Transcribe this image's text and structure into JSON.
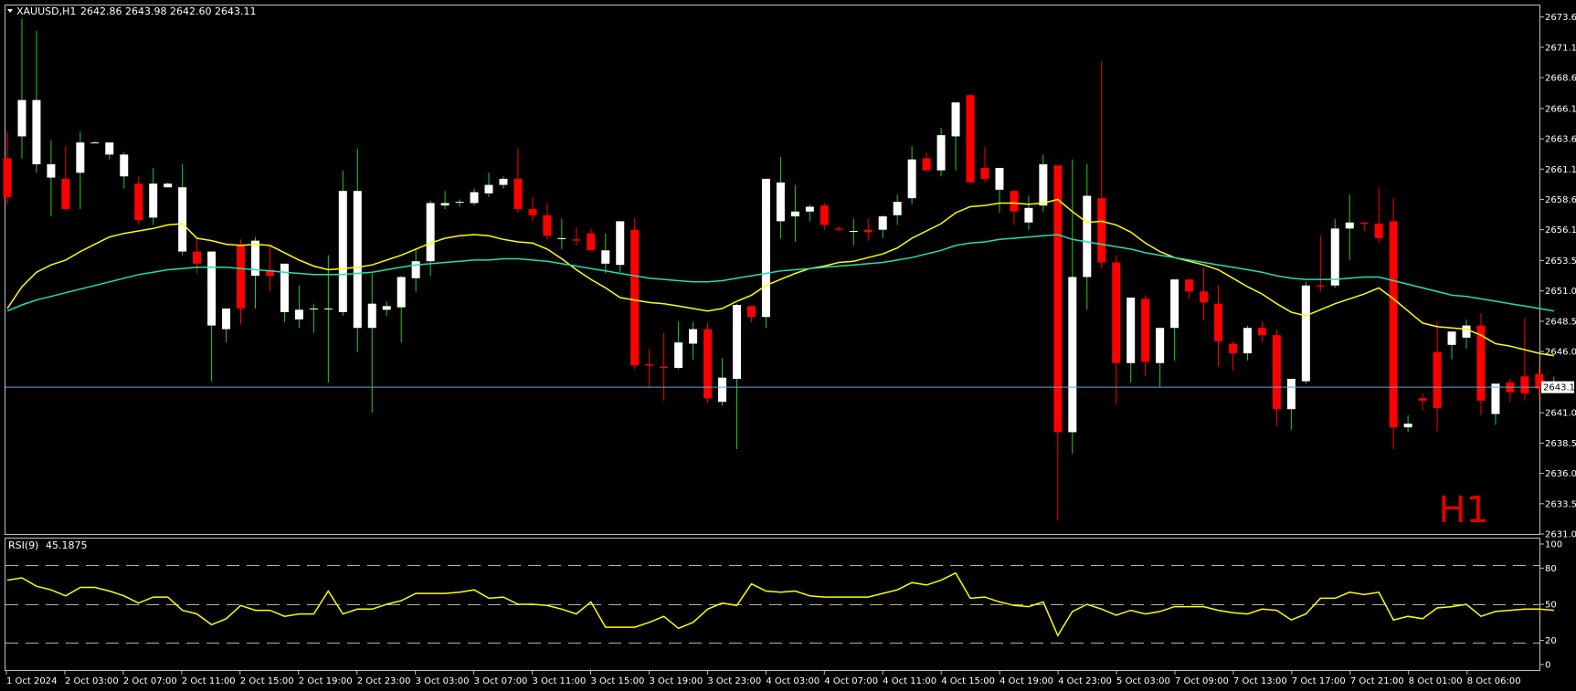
{
  "header": {
    "symbol": "XAUUSD,H1",
    "ohlc": "2642.86 2643.98 2642.60 2643.11",
    "timeframe_mark": "H1"
  },
  "rsi_header": {
    "label": "RSI(9)",
    "value": "45.1875"
  },
  "colors": {
    "background": "#000000",
    "bull_body": "#ffffff",
    "bull_wick": "#22cc22",
    "bear_body": "#ff0000",
    "fast_ma": "#ffff00",
    "slow_ma": "#20e0b0",
    "rsi_line": "#ffff00",
    "price_line": "#6aa0c8",
    "frame": "#c0c0c0"
  },
  "chart_data": [
    {
      "type": "candlestick",
      "title": "XAUUSD,H1",
      "ylim": [
        2631.0,
        2674.6
      ],
      "grid": false,
      "y_ticks": [
        "2673.65",
        "2671.15",
        "2668.65",
        "2666.10",
        "2663.60",
        "2661.10",
        "2658.60",
        "2656.10",
        "2653.55",
        "2651.05",
        "2648.55",
        "2646.05",
        "2641.00",
        "2638.50",
        "2636.00",
        "2633.50",
        "2631.00"
      ],
      "current_price": "2643.11",
      "x_tick_labels": [
        "1 Oct 2024",
        "2 Oct 03:00",
        "2 Oct 07:00",
        "2 Oct 11:00",
        "2 Oct 15:00",
        "2 Oct 19:00",
        "2 Oct 23:00",
        "3 Oct 03:00",
        "3 Oct 07:00",
        "3 Oct 11:00",
        "3 Oct 15:00",
        "3 Oct 19:00",
        "3 Oct 23:00",
        "4 Oct 03:00",
        "4 Oct 07:00",
        "4 Oct 11:00",
        "4 Oct 15:00",
        "4 Oct 19:00",
        "4 Oct 23:00",
        "5 Oct 03:00",
        "7 Oct 09:00",
        "7 Oct 13:00",
        "7 Oct 17:00",
        "7 Oct 21:00",
        "8 Oct 01:00",
        "8 Oct 06:00"
      ],
      "candles": [
        [
          2662.0,
          2664.2,
          2658.2,
          2658.8
        ],
        [
          2663.8,
          2673.5,
          2662.0,
          2666.8
        ],
        [
          2661.5,
          2672.5,
          2660.8,
          2666.8
        ],
        [
          2660.4,
          2663.5,
          2657.2,
          2661.5
        ],
        [
          2660.3,
          2663.0,
          2658.2,
          2657.8
        ],
        [
          2660.8,
          2664.2,
          2657.8,
          2663.3
        ],
        [
          2663.3,
          2663.4,
          2663.3,
          2663.3
        ],
        [
          2662.3,
          2663.3,
          2661.9,
          2663.3
        ],
        [
          2660.5,
          2662.5,
          2659.5,
          2662.3
        ],
        [
          2659.9,
          2660.5,
          2656.5,
          2656.9
        ],
        [
          2657.1,
          2661.2,
          2656.5,
          2659.9
        ],
        [
          2659.6,
          2660.0,
          2659.6,
          2659.9
        ],
        [
          2654.3,
          2661.5,
          2654.0,
          2659.6
        ],
        [
          2654.3,
          2655.5,
          2652.5,
          2653.3
        ],
        [
          2648.2,
          2654.3,
          2643.6,
          2654.3
        ],
        [
          2647.9,
          2649.6,
          2646.8,
          2649.6
        ],
        [
          2654.9,
          2655.3,
          2648.3,
          2649.6
        ],
        [
          2652.3,
          2655.5,
          2649.6,
          2655.2
        ],
        [
          2652.8,
          2654.8,
          2651.0,
          2652.3
        ],
        [
          2649.3,
          2653.3,
          2648.5,
          2653.3
        ],
        [
          2648.7,
          2651.5,
          2648.0,
          2649.5
        ],
        [
          2649.6,
          2650.0,
          2647.6,
          2649.6
        ],
        [
          2649.6,
          2654.0,
          2643.5,
          2649.6
        ],
        [
          2649.3,
          2661.0,
          2649.0,
          2659.3
        ],
        [
          2648.0,
          2662.8,
          2646.0,
          2659.3
        ],
        [
          2648.0,
          2652.5,
          2641.0,
          2650.0
        ],
        [
          2649.5,
          2650.2,
          2649.0,
          2649.8
        ],
        [
          2649.7,
          2652.3,
          2646.8,
          2652.2
        ],
        [
          2652.1,
          2654.5,
          2651.0,
          2653.5
        ],
        [
          2653.5,
          2658.5,
          2652.3,
          2658.3
        ],
        [
          2658.1,
          2659.3,
          2657.8,
          2658.3
        ],
        [
          2658.4,
          2658.6,
          2658.0,
          2658.4
        ],
        [
          2658.3,
          2659.5,
          2658.1,
          2659.2
        ],
        [
          2659.1,
          2660.8,
          2658.8,
          2659.8
        ],
        [
          2659.8,
          2660.5,
          2659.5,
          2660.3
        ],
        [
          2660.3,
          2662.8,
          2657.5,
          2657.8
        ],
        [
          2657.8,
          2658.8,
          2656.8,
          2657.3
        ],
        [
          2657.3,
          2658.3,
          2655.3,
          2655.6
        ],
        [
          2655.4,
          2657.0,
          2654.5,
          2655.4
        ],
        [
          2655.3,
          2656.3,
          2654.8,
          2655.2
        ],
        [
          2655.8,
          2656.2,
          2654.5,
          2654.4
        ],
        [
          2653.3,
          2655.8,
          2652.5,
          2654.4
        ],
        [
          2653.2,
          2656.5,
          2652.6,
          2656.8
        ],
        [
          2656.1,
          2657.0,
          2644.6,
          2644.9
        ],
        [
          2645.0,
          2646.3,
          2643.0,
          2644.9
        ],
        [
          2644.8,
          2647.6,
          2642.0,
          2644.7
        ],
        [
          2644.7,
          2648.5,
          2644.6,
          2646.8
        ],
        [
          2646.7,
          2648.5,
          2645.4,
          2647.9
        ],
        [
          2647.9,
          2648.4,
          2641.8,
          2642.2
        ],
        [
          2641.9,
          2645.5,
          2641.6,
          2643.9
        ],
        [
          2643.8,
          2650.0,
          2638.0,
          2649.9
        ],
        [
          2649.8,
          2649.8,
          2648.5,
          2648.9
        ],
        [
          2648.9,
          2660.3,
          2648.0,
          2660.3
        ],
        [
          2656.8,
          2662.1,
          2655.4,
          2660.0
        ],
        [
          2657.2,
          2659.8,
          2655.1,
          2657.6
        ],
        [
          2657.6,
          2658.2,
          2656.8,
          2658.0
        ],
        [
          2658.1,
          2658.3,
          2656.1,
          2656.5
        ],
        [
          2656.2,
          2656.4,
          2656.0,
          2656.1
        ],
        [
          2656.0,
          2657.0,
          2654.8,
          2656.0
        ],
        [
          2656.1,
          2657.0,
          2655.2,
          2655.9
        ],
        [
          2656.1,
          2657.3,
          2655.4,
          2657.2
        ],
        [
          2657.3,
          2659.0,
          2656.5,
          2658.4
        ],
        [
          2658.7,
          2663.0,
          2658.2,
          2661.9
        ],
        [
          2662.0,
          2662.5,
          2661.0,
          2661.0
        ],
        [
          2661.0,
          2664.5,
          2660.5,
          2663.9
        ],
        [
          2663.8,
          2666.5,
          2661.0,
          2666.6
        ],
        [
          2667.2,
          2667.3,
          2660.0,
          2660.0
        ],
        [
          2661.2,
          2662.9,
          2660.0,
          2660.3
        ],
        [
          2659.4,
          2661.0,
          2657.5,
          2661.2
        ],
        [
          2659.3,
          2659.3,
          2656.5,
          2657.6
        ],
        [
          2656.7,
          2658.9,
          2656.1,
          2657.9
        ],
        [
          2658.1,
          2662.3,
          2657.6,
          2661.5
        ],
        [
          2661.4,
          2661.4,
          2632.1,
          2639.4
        ],
        [
          2639.4,
          2661.9,
          2637.6,
          2652.2
        ],
        [
          2652.2,
          2661.5,
          2649.5,
          2658.9
        ],
        [
          2658.7,
          2670.0,
          2652.9,
          2653.4
        ],
        [
          2653.4,
          2654.0,
          2641.7,
          2645.1
        ],
        [
          2645.1,
          2649.7,
          2643.5,
          2650.5
        ],
        [
          2650.4,
          2650.7,
          2644.0,
          2645.2
        ],
        [
          2645.1,
          2648.0,
          2643.1,
          2648.0
        ],
        [
          2648.0,
          2651.5,
          2645.3,
          2652.0
        ],
        [
          2652.0,
          2652.0,
          2650.4,
          2651.0
        ],
        [
          2651.0,
          2653.0,
          2648.6,
          2650.1
        ],
        [
          2650.0,
          2651.5,
          2644.8,
          2646.9
        ],
        [
          2646.7,
          2646.9,
          2644.5,
          2645.9
        ],
        [
          2645.9,
          2648.2,
          2645.3,
          2648.0
        ],
        [
          2648.0,
          2648.5,
          2646.8,
          2647.4
        ],
        [
          2647.4,
          2647.9,
          2639.9,
          2641.3
        ],
        [
          2641.3,
          2643.8,
          2639.6,
          2643.8
        ],
        [
          2643.6,
          2651.8,
          2643.4,
          2651.5
        ],
        [
          2651.5,
          2655.6,
          2651.0,
          2651.4
        ],
        [
          2651.5,
          2657.0,
          2651.3,
          2656.2
        ],
        [
          2656.2,
          2659.0,
          2653.6,
          2656.7
        ],
        [
          2656.7,
          2656.7,
          2656.0,
          2656.6
        ],
        [
          2656.6,
          2659.5,
          2655.0,
          2655.4
        ],
        [
          2656.8,
          2658.7,
          2638.0,
          2639.8
        ],
        [
          2639.8,
          2640.8,
          2639.4,
          2640.1
        ],
        [
          2642.2,
          2642.6,
          2641.2,
          2642.0
        ],
        [
          2646.0,
          2648.5,
          2639.5,
          2641.4
        ],
        [
          2646.6,
          2647.0,
          2645.4,
          2647.7
        ],
        [
          2647.2,
          2648.7,
          2646.3,
          2648.2
        ],
        [
          2648.2,
          2649.2,
          2640.8,
          2642.0
        ],
        [
          2640.9,
          2643.3,
          2640.0,
          2643.4
        ],
        [
          2643.5,
          2643.8,
          2641.9,
          2642.7
        ],
        [
          2644.0,
          2648.8,
          2642.0,
          2642.6
        ],
        [
          2644.2,
          2644.8,
          2642.3,
          2643.0
        ],
        [
          2643.1,
          2644.0,
          2642.6,
          2643.1
        ]
      ],
      "moving_averages": [
        {
          "color": "#ffff00",
          "values": [
            2649.6,
            2651.4,
            2652.6,
            2653.2,
            2653.6,
            2654.3,
            2654.9,
            2655.5,
            2655.8,
            2656.0,
            2656.2,
            2656.5,
            2656.6,
            2655.4,
            2655.2,
            2654.9,
            2654.8,
            2654.9,
            2654.8,
            2654.2,
            2653.6,
            2653.1,
            2652.8,
            2652.9,
            2653.0,
            2653.2,
            2653.6,
            2654.0,
            2654.5,
            2655.0,
            2655.4,
            2655.6,
            2655.7,
            2655.6,
            2655.3,
            2655.1,
            2655.0,
            2654.5,
            2653.7,
            2652.8,
            2652.0,
            2651.3,
            2650.5,
            2650.3,
            2650.1,
            2650.0,
            2649.8,
            2649.6,
            2649.4,
            2649.6,
            2650.2,
            2650.7,
            2651.5,
            2652.0,
            2652.5,
            2652.9,
            2653.1,
            2653.4,
            2653.5,
            2653.8,
            2654.1,
            2654.6,
            2655.4,
            2656.0,
            2656.6,
            2657.5,
            2658.0,
            2658.1,
            2658.3,
            2658.3,
            2658.2,
            2658.3,
            2658.6,
            2657.6,
            2656.7,
            2656.8,
            2656.5,
            2655.9,
            2655.0,
            2654.3,
            2653.8,
            2653.5,
            2653.2,
            2652.8,
            2652.1,
            2651.4,
            2650.8,
            2650.0,
            2649.3,
            2649.0,
            2649.5,
            2650.0,
            2650.4,
            2650.8,
            2651.3,
            2650.4,
            2649.4,
            2648.4,
            2648.1,
            2648.0,
            2647.9,
            2647.4,
            2646.7,
            2646.5,
            2646.2,
            2645.9,
            2645.7
          ]
        },
        {
          "color": "#20e0b0",
          "values": [
            2649.4,
            2649.9,
            2650.3,
            2650.6,
            2650.9,
            2651.2,
            2651.5,
            2651.8,
            2652.1,
            2652.4,
            2652.6,
            2652.8,
            2652.9,
            2653.0,
            2653.0,
            2653.0,
            2652.9,
            2652.8,
            2652.7,
            2652.6,
            2652.5,
            2652.4,
            2652.4,
            2652.4,
            2652.5,
            2652.6,
            2652.8,
            2653.0,
            2653.2,
            2653.3,
            2653.4,
            2653.5,
            2653.6,
            2653.6,
            2653.7,
            2653.7,
            2653.6,
            2653.5,
            2653.3,
            2653.1,
            2652.9,
            2652.7,
            2652.5,
            2652.3,
            2652.1,
            2652.0,
            2651.9,
            2651.8,
            2651.8,
            2651.9,
            2652.1,
            2652.3,
            2652.5,
            2652.7,
            2652.8,
            2652.9,
            2653.0,
            2653.1,
            2653.2,
            2653.3,
            2653.4,
            2653.6,
            2653.8,
            2654.1,
            2654.4,
            2654.8,
            2655.0,
            2655.1,
            2655.3,
            2655.4,
            2655.5,
            2655.6,
            2655.7,
            2655.3,
            2655.1,
            2654.9,
            2654.7,
            2654.5,
            2654.2,
            2654.0,
            2653.8,
            2653.6,
            2653.4,
            2653.2,
            2653.0,
            2652.8,
            2652.6,
            2652.3,
            2652.1,
            2652.0,
            2652.0,
            2652.0,
            2652.1,
            2652.2,
            2652.2,
            2651.9,
            2651.6,
            2651.3,
            2651.0,
            2650.7,
            2650.6,
            2650.4,
            2650.2,
            2650.0,
            2649.8,
            2649.6,
            2649.4
          ]
        }
      ]
    },
    {
      "type": "line",
      "title": "RSI(9)",
      "ylim": [
        0,
        100
      ],
      "y_ticks": [
        "100",
        "80",
        "50",
        "20",
        "0"
      ],
      "levels": [
        80,
        50,
        20
      ],
      "values": [
        70,
        72,
        65,
        62,
        57,
        64,
        64,
        61,
        57,
        51,
        56,
        56,
        45,
        42,
        33,
        38,
        49,
        45,
        45,
        40,
        42,
        42,
        61,
        42,
        46,
        46,
        50,
        53,
        59,
        59,
        59,
        60,
        62,
        55,
        56,
        50,
        50,
        49,
        46,
        42,
        52,
        31,
        31,
        31,
        35,
        40,
        30,
        35,
        46,
        51,
        49,
        67,
        61,
        60,
        61,
        57,
        56,
        56,
        56,
        56,
        59,
        62,
        68,
        66,
        70,
        76,
        55,
        56,
        52,
        49,
        48,
        52,
        24,
        44,
        50,
        46,
        41,
        45,
        42,
        44,
        48,
        48,
        48,
        45,
        43,
        42,
        46,
        45,
        37,
        42,
        55,
        55,
        60,
        58,
        60,
        37,
        40,
        38,
        47,
        48,
        50,
        40,
        44,
        45,
        46,
        46,
        45
      ]
    }
  ]
}
